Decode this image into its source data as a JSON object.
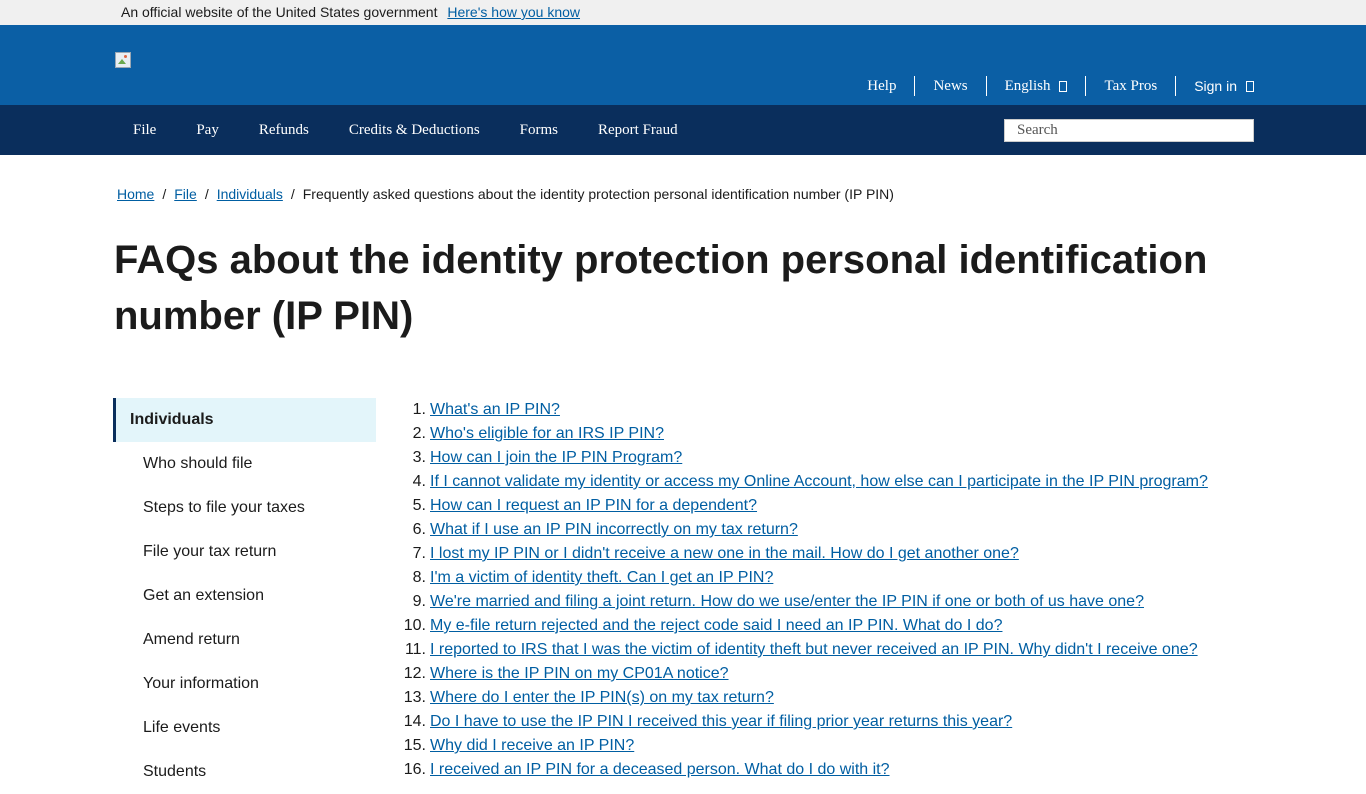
{
  "gov_banner": {
    "text": "An official website of the United States government",
    "link": "Here's how you know"
  },
  "header": {
    "utility_nav": {
      "help": "Help",
      "news": "News",
      "english": "English",
      "tax_pros": "Tax Pros",
      "sign_in": "Sign in"
    }
  },
  "main_nav": {
    "items": [
      "File",
      "Pay",
      "Refunds",
      "Credits & Deductions",
      "Forms",
      "Report Fraud"
    ],
    "search_placeholder": "Search"
  },
  "breadcrumb": {
    "items": [
      "Home",
      "File",
      "Individuals"
    ],
    "current": "Frequently asked questions about the identity protection personal identification number (IP PIN)"
  },
  "page_title": "FAQs about the identity protection personal identification number (IP PIN)",
  "sidebar": {
    "active": "Individuals",
    "items": [
      "Who should file",
      "Steps to file your taxes",
      "File your tax return",
      "Get an extension",
      "Amend return",
      "Your information",
      "Life events",
      "Students"
    ]
  },
  "faq": [
    {
      "num": "1.",
      "text": "What's an IP PIN?"
    },
    {
      "num": "2.",
      "text": "Who's eligible for an IRS IP PIN?"
    },
    {
      "num": "3.",
      "text": "How can I join the IP PIN Program?"
    },
    {
      "num": "4.",
      "text": "If I cannot validate my identity or access my Online Account, how else can I participate in the IP PIN program?"
    },
    {
      "num": "5.",
      "text": "How can I request an IP PIN for a dependent?"
    },
    {
      "num": "6.",
      "text": "What if I use an IP PIN incorrectly on my tax return?"
    },
    {
      "num": "7.",
      "text": "I lost my IP PIN or I didn't receive a new one in the mail. How do I get another one?"
    },
    {
      "num": "8.",
      "text": "I'm a victim of identity theft. Can I get an IP PIN?"
    },
    {
      "num": "9.",
      "text": "We're married and filing a joint return. How do we use/enter the IP PIN if one or both of us have one?"
    },
    {
      "num": "10.",
      "text": "My e-file return rejected and the reject code said I need an IP PIN. What do I do?"
    },
    {
      "num": "11.",
      "text": "I reported to IRS that I was the victim of identity theft but never received an IP PIN. Why didn't I receive one?"
    },
    {
      "num": "12.",
      "text": "Where is the IP PIN on my CP01A notice?"
    },
    {
      "num": "13.",
      "text": "Where do I enter the IP PIN(s) on my tax return?"
    },
    {
      "num": "14.",
      "text": "Do I have to use the IP PIN I received this year if filing prior year returns this year?"
    },
    {
      "num": "15.",
      "text": "Why did I receive an IP PIN?"
    },
    {
      "num": "16.",
      "text": "I received an IP PIN for a deceased person. What do I do with it?"
    }
  ]
}
